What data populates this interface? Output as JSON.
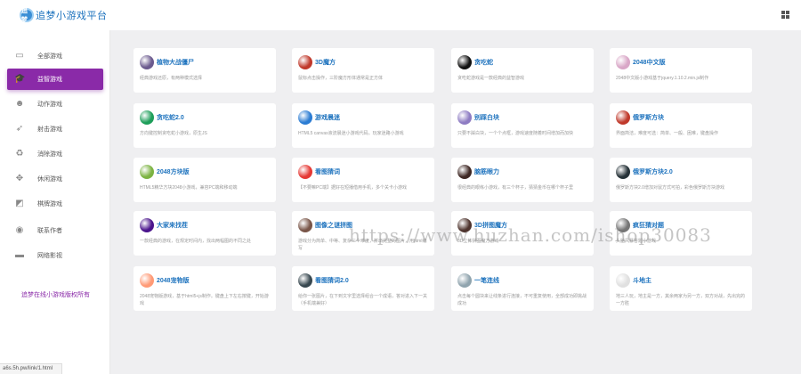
{
  "brand": {
    "logo_text": "追梦",
    "name": "追梦小游戏平台"
  },
  "sidebar": {
    "items": [
      {
        "label": "全部游戏",
        "icon": "twitch-icon",
        "glyph": "▭"
      },
      {
        "label": "益智游戏",
        "icon": "graduation-cap-icon",
        "glyph": "🎓"
      },
      {
        "label": "动作游戏",
        "icon": "reddit-icon",
        "glyph": "☻"
      },
      {
        "label": "射击游戏",
        "icon": "rocket-icon",
        "glyph": "➶"
      },
      {
        "label": "消除游戏",
        "icon": "recycle-icon",
        "glyph": "♻"
      },
      {
        "label": "休闲游戏",
        "icon": "expand-arrows-icon",
        "glyph": "✥"
      },
      {
        "label": "棋牌游戏",
        "icon": "puzzle-piece-icon",
        "glyph": "◩"
      },
      {
        "label": "联系作者",
        "icon": "user-icon",
        "glyph": "◉"
      },
      {
        "label": "网络影视",
        "icon": "laptop-icon",
        "glyph": "▬"
      }
    ],
    "active_index": 1,
    "copyright": "追梦在线小游戏版权所有"
  },
  "status_url": "a6s.5h.pw/link/1.html",
  "watermark": "https://www.huzhan.com/ishop30083",
  "games": [
    {
      "title": "植物大战僵尸",
      "desc": "经典游戏还原，有两种模式选择",
      "icon": "plants-vs-zombies-icon",
      "color": "#6b5a8e"
    },
    {
      "title": "3D魔方",
      "desc": "鼠标点击操作，三阶魔方形体通常是正方体",
      "icon": "rubiks-cube-icon",
      "color": "#c0392b"
    },
    {
      "title": "贪吃蛇",
      "desc": "贪吃蛇游戏是一款经典的益智游戏",
      "icon": "snake-icon",
      "color": "#111111"
    },
    {
      "title": "2048中文版",
      "desc": "2048中文版小游戏基于jquery.1.10.2.min.js制作",
      "icon": "2048-icon",
      "color": "#d9a7c7"
    },
    {
      "title": "贪吃蛇2.0",
      "desc": "方向键控制贪吃蛇小游戏，原生JS",
      "icon": "snake-2-icon",
      "color": "#1e9e5a"
    },
    {
      "title": "游戏晨迷",
      "desc": "HTML5 canvas液流晨迷小游戏代码，玩家迷路小游戏",
      "icon": "maze-game-icon",
      "color": "#2b7cd3"
    },
    {
      "title": "别踩白块",
      "desc": "只要不踩白块，一个个点框，游戏速度随着时间增加而加快",
      "icon": "dont-tap-white-icon",
      "color": "#8e7cc3"
    },
    {
      "title": "俄罗斯方块",
      "desc": "界面简洁，难度可选：简单、一般、困难，键盘操作",
      "icon": "tetris-icon",
      "color": "#c0392b"
    },
    {
      "title": "2048方块版",
      "desc": "HTML5精华方块2048小游戏，兼容PC端和移动端",
      "icon": "2048-block-icon",
      "color": "#7cb342"
    },
    {
      "title": "看图猜词",
      "desc": "【不要嘛PC端】据好在短播借用手机，多个关卡小游戏",
      "icon": "guess-word-icon",
      "color": "#e53935"
    },
    {
      "title": "脑筋眼力",
      "desc": "很经典的眼练小游戏，有三个杯子，猜猜金币在哪个杯子里",
      "icon": "eyesight-icon",
      "color": "#3e2723"
    },
    {
      "title": "俄罗斯方块2.0",
      "desc": "俄罗斯方块2.0增加对鼠方式可拍，彩色俄罗斯方块游戏",
      "icon": "tetris-2-icon",
      "color": "#263238"
    },
    {
      "title": "大家来找茬",
      "desc": "一款经典的游戏，在规定时间内，找出两幅图的不同之处",
      "icon": "spot-difference-icon",
      "color": "#4a148c"
    },
    {
      "title": "图像之谜拼图",
      "desc": "游戏分为简单、中等、复杂三个难度，拼出完整的图片，用html编写",
      "icon": "jigsaw-icon",
      "color": "#795548"
    },
    {
      "title": "3D拼图魔方",
      "desc": "3D立体拼图魔方游戏",
      "icon": "3d-puzzle-icon",
      "color": "#4e342e"
    },
    {
      "title": "疯狂猜对题",
      "desc": "头脑风暴答题小游戏",
      "icon": "quiz-icon",
      "color": "#757575"
    },
    {
      "title": "2048宠物版",
      "desc": "2048宠物版游戏，基于html5+js制作。键盘上下左右按键，开始游戏",
      "icon": "2048-pet-icon",
      "color": "#ff9a76"
    },
    {
      "title": "看图猜词2.0",
      "desc": "给你一张图片，在下到文字里选择组合一个成语，答对进入下一关（手机端兼好）",
      "icon": "guess-word-2-icon",
      "color": "#37474f"
    },
    {
      "title": "一笔连线",
      "desc": "点击每个圆块来让线条进行连接，不可重复使用，全部成功即挑战成功",
      "icon": "one-stroke-icon",
      "color": "#90a4ae"
    },
    {
      "title": "斗地主",
      "desc": "地三人玩，地主是一方，其余两家为另一方，双方对战，先出完的一方胜",
      "icon": "dou-dizhu-icon",
      "color": "#e0e0e0"
    }
  ]
}
